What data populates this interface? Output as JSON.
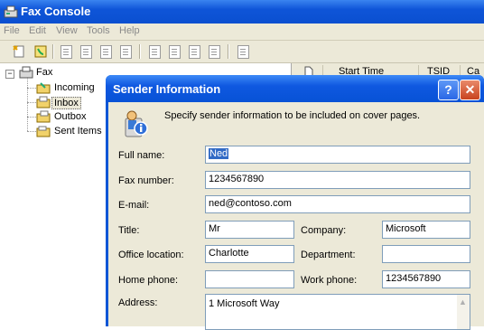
{
  "window": {
    "title": "Fax Console",
    "menu": [
      "File",
      "Edit",
      "View",
      "Tools",
      "Help"
    ]
  },
  "tree": {
    "root": "Fax",
    "items": [
      "Incoming",
      "Inbox",
      "Outbox",
      "Sent Items"
    ],
    "selected": "Inbox"
  },
  "list": {
    "columns": [
      "Start Time",
      "TSID",
      "Ca"
    ]
  },
  "dialog": {
    "title": "Sender Information",
    "help_label": "?",
    "close_label": "✕",
    "intro": "Specify sender information to be included on cover pages.",
    "labels": {
      "full_name": "Full name:",
      "fax_number": "Fax number:",
      "email": "E-mail:",
      "title": "Title:",
      "company": "Company:",
      "office_location": "Office location:",
      "department": "Department:",
      "home_phone": "Home phone:",
      "work_phone": "Work phone:",
      "address": "Address:"
    },
    "values": {
      "full_name": "Ned",
      "fax_number": "1234567890",
      "email": "ned@contoso.com",
      "title": "Mr",
      "company": "Microsoft",
      "office_location": "Charlotte",
      "department": "",
      "home_phone": "",
      "work_phone": "1234567890",
      "address": "1 Microsoft Way"
    }
  },
  "colors": {
    "titlebar": "#0a4fd0",
    "selection": "#316ac5",
    "field_border": "#7f9db9"
  }
}
